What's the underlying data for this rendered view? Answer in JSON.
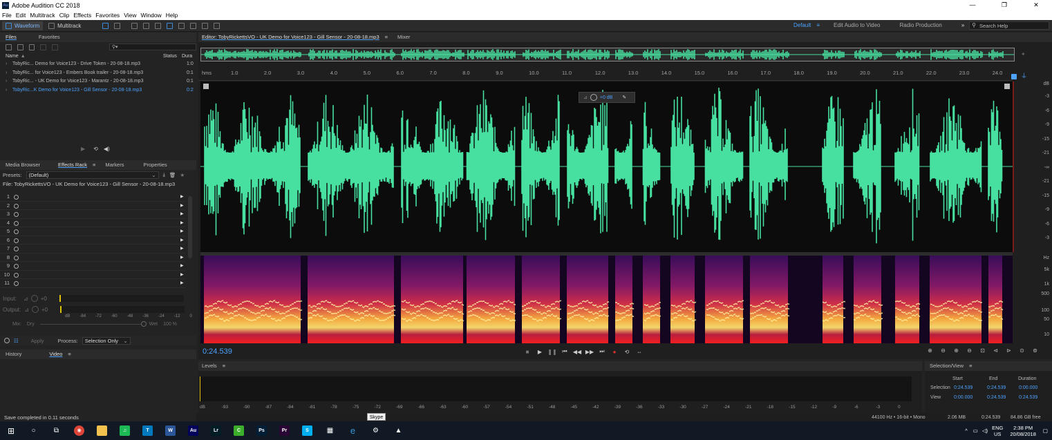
{
  "window": {
    "title": "Adobe Audition CC 2018",
    "app_icon_label": "Au",
    "controls": [
      "—",
      "❐",
      "✕"
    ]
  },
  "menu": [
    "File",
    "Edit",
    "Multitrack",
    "Clip",
    "Effects",
    "Favorites",
    "View",
    "Window",
    "Help"
  ],
  "toolbar": {
    "view_tabs": [
      "Waveform",
      "Multitrack"
    ],
    "workspaces": [
      "Default",
      "Edit Audio to Video",
      "Radio Production"
    ],
    "more": "»",
    "search_placeholder": "Search Help"
  },
  "files_panel": {
    "tabs": [
      "Files",
      "Favorites"
    ],
    "columns": {
      "name": "Name",
      "status": "Status",
      "duration": "Dura"
    },
    "rows": [
      {
        "name": "TobyRic... Demo for Voice123 - Drive Token - 20-08-18.mp3",
        "duration": "1:0"
      },
      {
        "name": "TobyRic... for Voice123 - Embers Book trailer - 20-08-18.mp3",
        "duration": "0:1"
      },
      {
        "name": "TobyRic... - UK Demo for Voice123 - Marantz - 20-08-18.mp3",
        "duration": "0:1"
      },
      {
        "name": "TobyRic...K Demo for Voice123 - Gill Sensor - 20-08-18.mp3",
        "duration": "0:2"
      }
    ]
  },
  "effects_panel": {
    "tabs": [
      "Media Browser",
      "Effects Rack",
      "Markers",
      "Properties"
    ],
    "presets_label": "Presets:",
    "presets_value": "(Default)",
    "file_label": "File: TobyRickettsVO - UK Demo for Voice123 - Gill Sensor - 20-08-18.mp3",
    "slots": [
      "1",
      "2",
      "3",
      "4",
      "5",
      "6",
      "7",
      "8",
      "9",
      "10",
      "11"
    ],
    "input_label": "Input:",
    "output_label": "Output:",
    "input_value": "+0",
    "output_value": "+0",
    "meter_ticks": [
      "dB",
      "-84",
      "-72",
      "-60",
      "-48",
      "-36",
      "-24",
      "-12",
      "0"
    ],
    "mix_label": "Mix:",
    "dry_label": "Dry",
    "wet_label": "Wet",
    "wet_value": "100 %",
    "apply_label": "Apply",
    "process_label": "Process:",
    "process_value": "Selection Only"
  },
  "bottom_left": {
    "tabs": [
      "History",
      "Video"
    ],
    "status": "Save completed in 0.11 seconds"
  },
  "editor": {
    "tab_label": "Editor: TobyRickettsVO - UK Demo for Voice123 - Gill Sensor - 20-08-18.mp3",
    "mixer_label": "Mixer",
    "ruler_unit": "hms",
    "ruler_ticks": [
      "1.0",
      "2.0",
      "3.0",
      "4.0",
      "5.0",
      "6.0",
      "7.0",
      "8.0",
      "9.0",
      "10.0",
      "11.0",
      "12.0",
      "13.0",
      "14.0",
      "15.0",
      "16.0",
      "17.0",
      "18.0",
      "19.0",
      "20.0",
      "21.0",
      "22.0",
      "23.0",
      "24.0"
    ],
    "gain_hud": "+0 dB",
    "db_scale": [
      "dB",
      "-3",
      "-6",
      "-9",
      "-15",
      "-21",
      "-∞",
      "-21",
      "-15",
      "-9",
      "-6",
      "-3"
    ],
    "hz_scale": [
      "Hz",
      "5k",
      "1k",
      "500",
      "100",
      "50",
      "10"
    ],
    "current_time": "0:24.539",
    "colors": {
      "waveform": "#47e0a0",
      "time": "#4da3ff",
      "spectral_low": "#2a0a4a",
      "spectral_high": "#ffe070"
    }
  },
  "levels_panel": {
    "title": "Levels",
    "ticks": [
      "dB",
      "-93",
      "-90",
      "-87",
      "-84",
      "-81",
      "-78",
      "-75",
      "-72",
      "-69",
      "-66",
      "-63",
      "-60",
      "-57",
      "-54",
      "-51",
      "-48",
      "-45",
      "-42",
      "-39",
      "-36",
      "-33",
      "-30",
      "-27",
      "-24",
      "-21",
      "-18",
      "-15",
      "-12",
      "-9",
      "-6",
      "-3",
      "0"
    ]
  },
  "selection_view": {
    "title": "Selection/View",
    "headers": [
      "Start",
      "End",
      "Duration"
    ],
    "selection": {
      "label": "Selection",
      "start": "0:24.539",
      "end": "0:24.539",
      "duration": "0:00.000"
    },
    "view": {
      "label": "View",
      "start": "0:00.000",
      "end": "0:24.539",
      "duration": "0:24.539"
    }
  },
  "statusbar": {
    "format": "44100 Hz • 16-bit • Mono",
    "size": "2.06 MB",
    "duration": "0:24.539",
    "free": "84.86 GB free"
  },
  "taskbar": {
    "tooltip": "Skype",
    "lang": "ENG",
    "region": "US",
    "time": "2:38 PM",
    "date": "20/08/2018",
    "apps": [
      {
        "id": "spotify",
        "label": "♫",
        "color": "#1db954"
      },
      {
        "id": "trello",
        "label": "T",
        "color": "#0079bf"
      },
      {
        "id": "word",
        "label": "W",
        "color": "#2b579a"
      },
      {
        "id": "audition",
        "label": "Au",
        "color": "#00005b"
      },
      {
        "id": "lightroom",
        "label": "Lr",
        "color": "#001d26"
      },
      {
        "id": "camtasia",
        "label": "C",
        "color": "#3dae2b"
      },
      {
        "id": "photoshop",
        "label": "Ps",
        "color": "#001e36"
      },
      {
        "id": "premiere",
        "label": "Pr",
        "color": "#2a0634"
      },
      {
        "id": "skype",
        "label": "S",
        "color": "#00aff0"
      }
    ]
  }
}
